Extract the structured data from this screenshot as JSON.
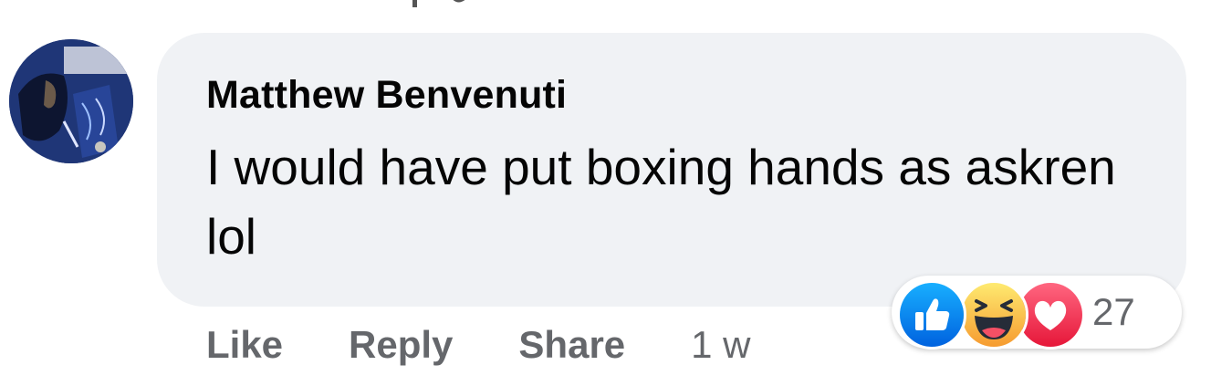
{
  "comment": {
    "author": "Matthew Benvenuti",
    "text": "I would have put boxing hands as askren lol"
  },
  "actions": {
    "like_label": "Like",
    "reply_label": "Reply",
    "share_label": "Share",
    "timestamp": "1 w"
  },
  "reactions": {
    "icons": [
      "like-reaction-icon",
      "haha-reaction-icon",
      "love-reaction-icon"
    ],
    "count": "27"
  },
  "colors": {
    "bubble": "#f0f2f5",
    "text": "#050505",
    "secondary_text": "#65676b",
    "like_blue": "#1877f2",
    "haha_yellow": "#f7b125",
    "love_red": "#f33e58"
  }
}
